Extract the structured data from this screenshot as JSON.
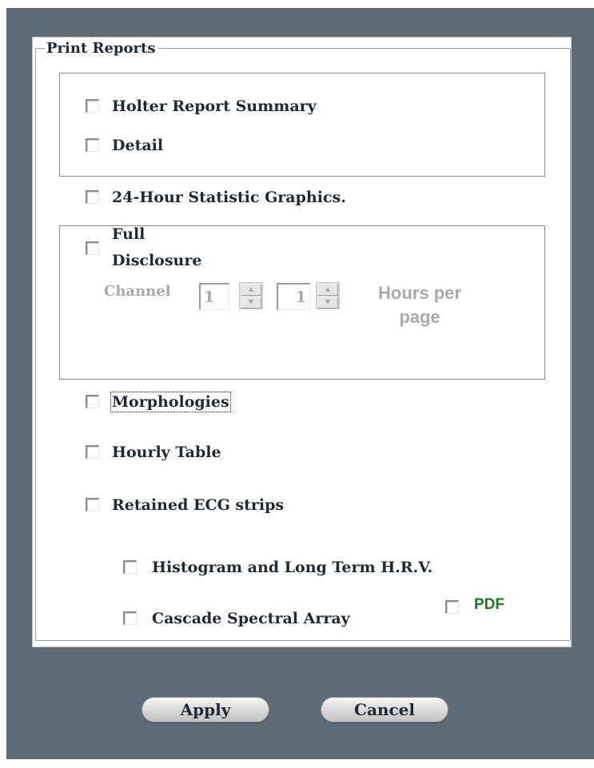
{
  "group": {
    "legend": "Print Reports"
  },
  "options": {
    "holter_summary": "Holter Report Summary",
    "detail": "Detail",
    "stat_graphics": "24-Hour Statistic Graphics.",
    "full_disclosure_line1": "Full",
    "full_disclosure_line2": "Disclosure",
    "morphologies": "Morphologies",
    "hourly_table": "Hourly Table",
    "retained_ecg": "Retained ECG strips",
    "histogram_hrv": "Histogram and Long Term H.R.V.",
    "cascade_spectral": "Cascade Spectral Array",
    "pdf": "PDF"
  },
  "full_disclosure": {
    "channel_label": "Channel",
    "channel_value": "1",
    "hours_value": "1",
    "hours_label_line1": "Hours per",
    "hours_label_line2": "page"
  },
  "buttons": {
    "apply": "Apply",
    "cancel": "Cancel"
  },
  "colors": {
    "frame": "#5e6c78",
    "pdf_label": "#1b7a1b",
    "disabled_text": "#a9a9a9"
  }
}
